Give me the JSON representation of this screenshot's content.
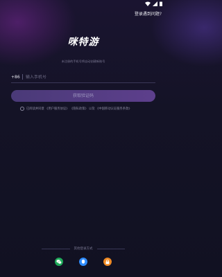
{
  "header": {
    "help_text": "登录遇到问题?"
  },
  "brand": {
    "logo_text": "咪特游"
  },
  "hint": "未注册的手机号将自动创建新账号",
  "phone": {
    "country_code": "+86",
    "placeholder": "输入手机号"
  },
  "get_code_label": "获取验证码",
  "agreement": {
    "prefix": "已阅读并同意",
    "user_agreement": "《用户服务协议》",
    "privacy": "《隐私政策》",
    "connector": "以及",
    "mobile_agreement": "《中国移动认证服务条款》"
  },
  "other_login": {
    "label": "其他登录方式"
  },
  "colors": {
    "wechat": "#1faa5a",
    "qq": "#2f8cff",
    "lock": "#f08a24"
  }
}
